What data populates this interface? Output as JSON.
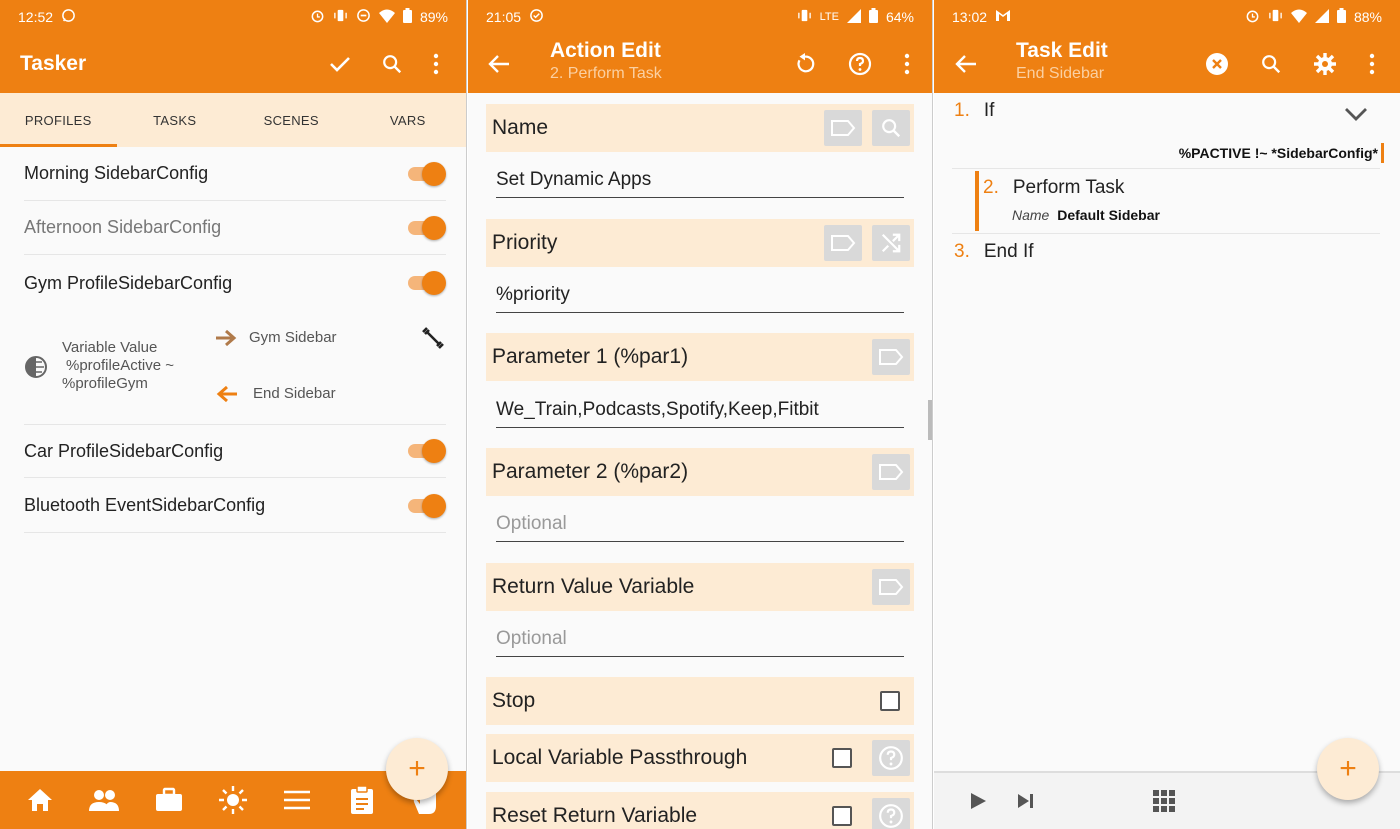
{
  "colors": {
    "accent": "#ee8012",
    "accent_light": "#fdebd4",
    "status_bar": "#ee8012"
  },
  "panel1": {
    "status": {
      "time": "12:52",
      "battery": "89%"
    },
    "title": "Tasker",
    "tabs": [
      "PROFILES",
      "TASKS",
      "SCENES",
      "VARS"
    ],
    "active_tab": "PROFILES",
    "profiles": [
      {
        "name": "Morning SidebarConfig",
        "enabled": true
      },
      {
        "name": "Afternoon SidebarConfig",
        "enabled": true
      },
      {
        "name": "Gym ProfileSidebarConfig",
        "enabled": true
      },
      {
        "name": "Car ProfileSidebarConfig",
        "enabled": true
      },
      {
        "name": "Bluetooth EventSidebarConfig",
        "enabled": true
      }
    ],
    "context": {
      "condition_line1": "Variable Value",
      "condition_line2": "%profileActive ~",
      "condition_line3": "%profileGym",
      "enter_task": "Gym Sidebar",
      "exit_task": "End Sidebar"
    },
    "fab_label": "+"
  },
  "panel2": {
    "status": {
      "time": "21:05",
      "network": "LTE",
      "battery": "64%"
    },
    "title": "Action Edit",
    "subtitle": "2. Perform Task",
    "fields": [
      {
        "label": "Name",
        "value": "Set Dynamic Apps",
        "placeholder": ""
      },
      {
        "label": "Priority",
        "value": "%priority",
        "placeholder": ""
      },
      {
        "label": "Parameter 1 (%par1)",
        "value": "We_Train,Podcasts,Spotify,Keep,Fitbit",
        "placeholder": ""
      },
      {
        "label": "Parameter 2 (%par2)",
        "value": "",
        "placeholder": "Optional"
      },
      {
        "label": "Return Value Variable",
        "value": "",
        "placeholder": "Optional"
      }
    ],
    "checks": [
      {
        "label": "Stop",
        "checked": false
      },
      {
        "label": "Local Variable Passthrough",
        "checked": false
      },
      {
        "label": "Reset Return Variable",
        "checked": false
      }
    ]
  },
  "panel3": {
    "status": {
      "time": "13:02",
      "battery": "88%"
    },
    "title": "Task Edit",
    "subtitle": "End Sidebar",
    "steps": [
      {
        "num": "1.",
        "label": "If",
        "condition": "%PACTIVE !~ *SidebarConfig*"
      },
      {
        "num": "2.",
        "label": "Perform Task",
        "param_name": "Name",
        "param_value": "Default Sidebar"
      },
      {
        "num": "3.",
        "label": "End If"
      }
    ],
    "fab_label": "+"
  }
}
